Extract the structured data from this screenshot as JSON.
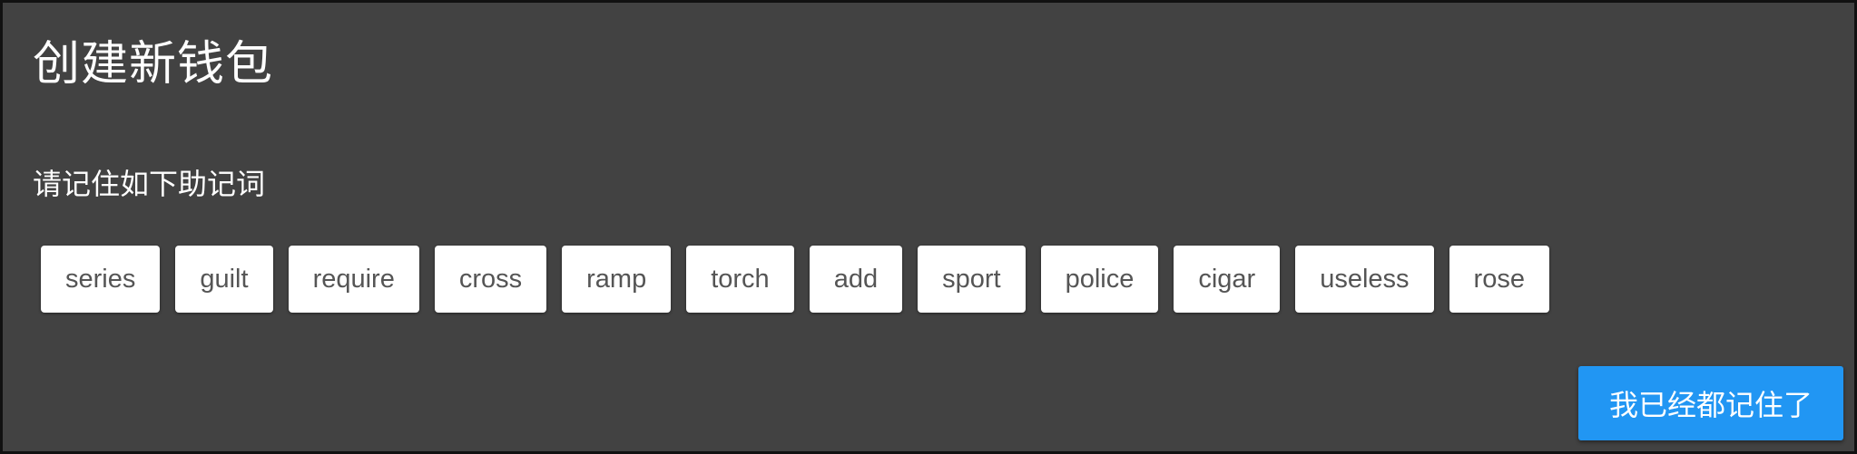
{
  "dialog": {
    "title": "创建新钱包",
    "instruction": "请记住如下助记词",
    "mnemonic_words": [
      "series",
      "guilt",
      "require",
      "cross",
      "ramp",
      "torch",
      "add",
      "sport",
      "police",
      "cigar",
      "useless",
      "rose"
    ],
    "confirm_label": "我已经都记住了"
  },
  "colors": {
    "background": "#424242",
    "border": "#111111",
    "chip_background": "#ffffff",
    "chip_text": "#555555",
    "accent_button": "#2196f3",
    "text": "#ffffff"
  }
}
